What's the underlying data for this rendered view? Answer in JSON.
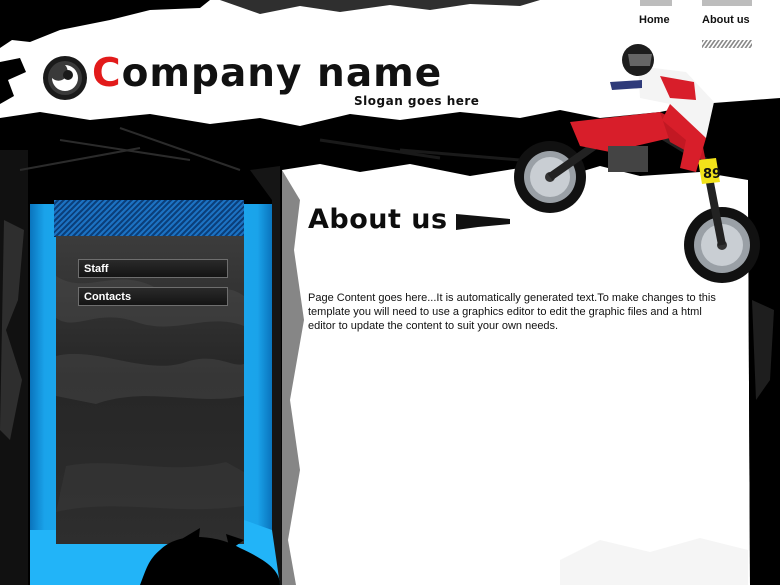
{
  "header": {
    "logo_first_letter": "C",
    "logo_rest": "ompany name",
    "slogan": "Slogan goes here"
  },
  "nav": {
    "items": [
      {
        "label": "Home"
      },
      {
        "label": "About us"
      }
    ]
  },
  "sidebar": {
    "items": [
      {
        "label": "Staff"
      },
      {
        "label": "Contacts"
      }
    ]
  },
  "main": {
    "heading": "About us",
    "body": "Page Content goes here...It is automatically generated text.To make changes to this template you will need to use a graphics editor to edit the graphic files and a html editor to update the content to suit your own needs."
  },
  "colors": {
    "accent_red": "#e21b1b",
    "sidebar_blue": "#22b4f8",
    "grunge_black": "#000000"
  }
}
